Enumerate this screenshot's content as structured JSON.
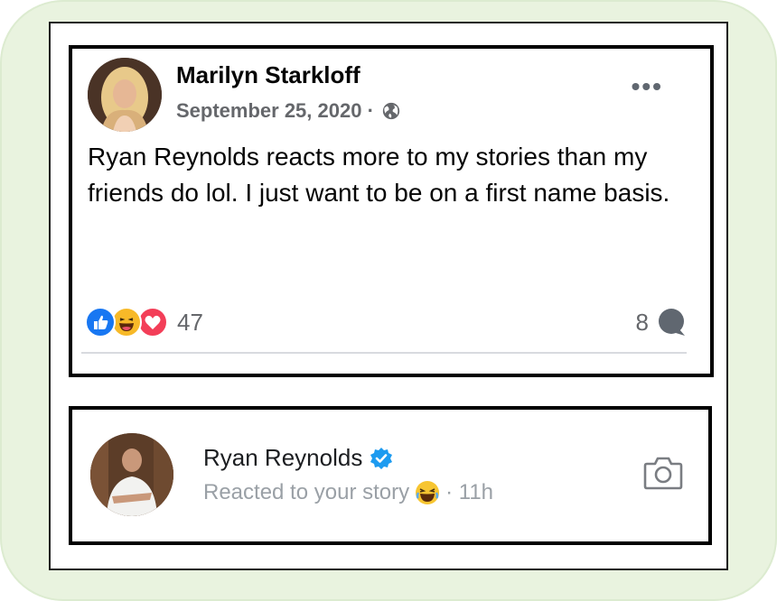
{
  "post": {
    "author": "Marilyn Starkloff",
    "date": "September 25, 2020 ·",
    "privacy_icon": "globe-icon",
    "menu_icon": "more-options-icon",
    "menu_label": "•••",
    "text": "Ryan Reynolds reacts more to my stories than my friends do lol. I just want to be on a first name basis.",
    "reactions": {
      "icons": [
        "like-icon",
        "haha-icon",
        "love-icon"
      ],
      "count": "47"
    },
    "comments": {
      "count": "8",
      "icon": "comment-bubble-icon"
    }
  },
  "story_reaction": {
    "name": "Ryan Reynolds",
    "verified_icon": "verified-badge-icon",
    "subtitle": "Reacted to your story",
    "emoji": "laughing-emoji-icon",
    "time": "· 11h",
    "action_icon": "camera-icon"
  },
  "colors": {
    "frame_background": "#e9f3df",
    "like_blue": "#1877f2",
    "love_red": "#f33e58",
    "haha_yellow": "#f7b928",
    "verified_blue": "#1d9bf0",
    "secondary_text": "#65676b"
  }
}
